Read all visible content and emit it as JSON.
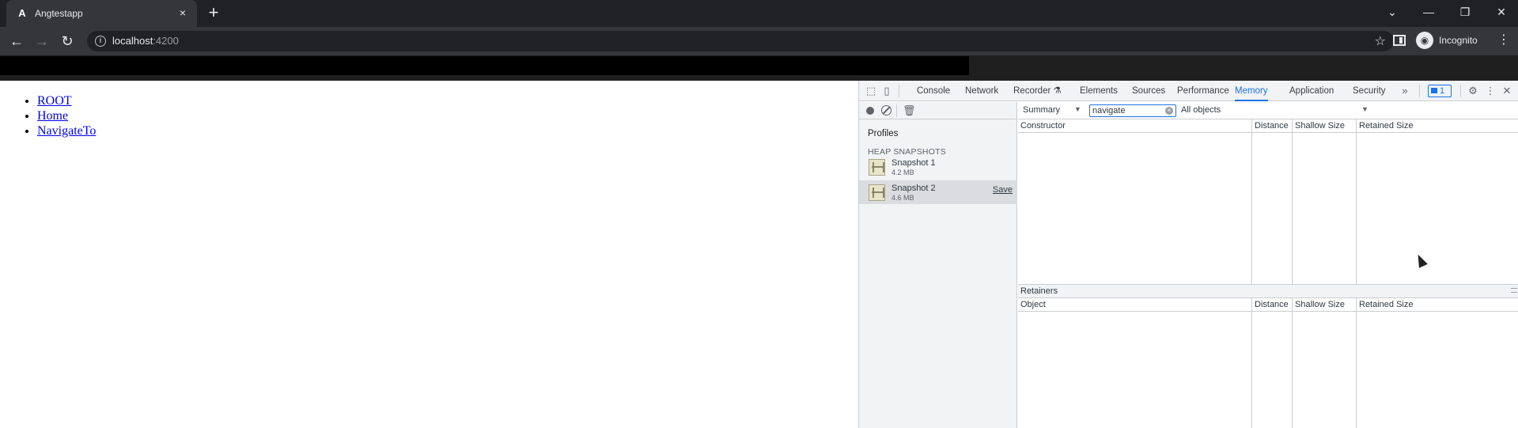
{
  "browser": {
    "tab": {
      "favicon": "A",
      "title": "Angtestapp",
      "close_icon": "×"
    },
    "new_tab_icon": "+",
    "window_controls": [
      "⌄",
      "—",
      "❐",
      "✕"
    ],
    "nav": {
      "back": "←",
      "forward": "→",
      "reload": "↻"
    },
    "url": {
      "host": "localhost",
      "port": ":4200"
    },
    "bookmark_icon": "☆",
    "profile_label": "Incognito",
    "menu_icon": "⋮"
  },
  "page": {
    "links": [
      "ROOT",
      "Home",
      "NavigateTo"
    ]
  },
  "devtools": {
    "tabs": [
      "Console",
      "Network",
      "Recorder",
      "Elements",
      "Sources",
      "Performance",
      "Memory",
      "Application",
      "Security"
    ],
    "recorder_flask": "⚗",
    "active_tab": "Memory",
    "more_tabs": "»",
    "issues_count": "1",
    "settings_icon": "⚙",
    "more_icon": "⋮",
    "close_icon": "✕",
    "sidebar": {
      "profiles_label": "Profiles",
      "section_label": "HEAP SNAPSHOTS",
      "snapshots": [
        {
          "name": "Snapshot 1",
          "size": "4.2 MB"
        },
        {
          "name": "Snapshot 2",
          "size": "4.6 MB",
          "action": "Save"
        }
      ],
      "trash_icon": "🗑"
    },
    "filter": {
      "view": "Summary",
      "class_filter_value": "navigate",
      "objects": "All objects",
      "dropdown_arrow": "▼"
    },
    "constructor_grid": {
      "columns": [
        "Constructor",
        "Distance",
        "Shallow Size",
        "Retained Size"
      ]
    },
    "retainers": {
      "title": "Retainers",
      "columns": [
        "Object",
        "Distance",
        "Shallow Size",
        "Retained Size"
      ]
    }
  }
}
